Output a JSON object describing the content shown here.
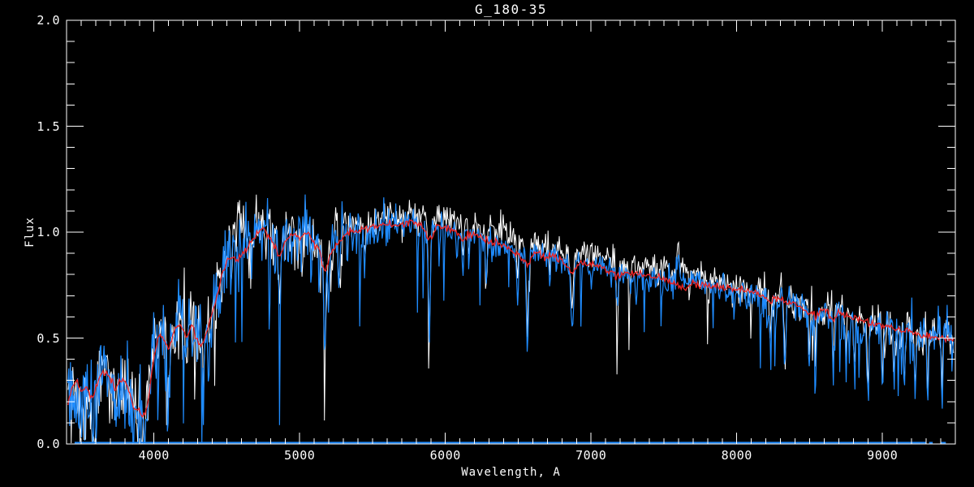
{
  "window": {
    "background": "#000000"
  },
  "chart_data": {
    "type": "line",
    "title": "G_180-35",
    "xlabel": "Wavelength, A",
    "ylabel": "Flux",
    "xlim": [
      3400,
      9500
    ],
    "ylim": [
      0.0,
      2.0
    ],
    "grid": false,
    "legend": null,
    "axis_color": "#ffffff",
    "background_color": "#000000",
    "x_major_ticks": [
      4000,
      5000,
      6000,
      7000,
      8000,
      9000
    ],
    "x_tick_labels": [
      "4000",
      "5000",
      "6000",
      "7000",
      "8000",
      "9000"
    ],
    "x_minor_step": 100,
    "y_major_ticks": [
      0.0,
      0.5,
      1.0,
      1.5,
      2.0
    ],
    "y_tick_labels": [
      "0.0",
      "0.5",
      "1.0",
      "1.5",
      "2.0"
    ],
    "y_minor_step": 0.1,
    "series": [
      {
        "name": "observed-spectrum-white",
        "color": "#ffffff",
        "role": "noisy observed spectrum (drawn first, visible behind blue)",
        "seed": 7654321,
        "sigma_scale": 0.95,
        "line_scale": 0.85,
        "dip_scale": 0.55,
        "spike_scale": 1.0,
        "offset_profile": [
          [
            3400,
            0.005
          ],
          [
            5200,
            0.01
          ],
          [
            5500,
            0.045
          ],
          [
            6600,
            0.05
          ],
          [
            7200,
            0.04
          ],
          [
            7800,
            0.03
          ],
          [
            8400,
            0.025
          ],
          [
            9000,
            0.02
          ],
          [
            9500,
            0.015
          ]
        ]
      },
      {
        "name": "observed-spectrum-blue",
        "color": "#1f8cff",
        "role": "noisy observed spectrum overlay",
        "seed": 1234567,
        "sigma_scale": 1.0,
        "line_scale": 1.0,
        "dip_scale": 1.0,
        "spike_scale": 1.0,
        "offset_profile": [
          [
            3400,
            0.0
          ],
          [
            9500,
            0.0
          ]
        ]
      },
      {
        "name": "model-spectrum-red",
        "color": "#f02424",
        "role": "smooth template / model spectrum",
        "seed": 24601,
        "sigma": 0.009,
        "step_angstrom": 8
      }
    ],
    "continuum_anchors": [
      [
        3410,
        0.25
      ],
      [
        3440,
        0.3
      ],
      [
        3470,
        0.24
      ],
      [
        3500,
        0.21
      ],
      [
        3530,
        0.3
      ],
      [
        3560,
        0.18
      ],
      [
        3590,
        0.16
      ],
      [
        3620,
        0.3
      ],
      [
        3650,
        0.36
      ],
      [
        3680,
        0.34
      ],
      [
        3710,
        0.3
      ],
      [
        3740,
        0.24
      ],
      [
        3770,
        0.29
      ],
      [
        3800,
        0.27
      ],
      [
        3830,
        0.24
      ],
      [
        3860,
        0.14
      ],
      [
        3900,
        0.19
      ],
      [
        3933,
        0.12
      ],
      [
        3960,
        0.26
      ],
      [
        4000,
        0.5
      ],
      [
        4040,
        0.56
      ],
      [
        4070,
        0.52
      ],
      [
        4101,
        0.48
      ],
      [
        4140,
        0.56
      ],
      [
        4180,
        0.58
      ],
      [
        4220,
        0.57
      ],
      [
        4260,
        0.6
      ],
      [
        4300,
        0.5
      ],
      [
        4340,
        0.53
      ],
      [
        4380,
        0.6
      ],
      [
        4420,
        0.68
      ],
      [
        4460,
        0.82
      ],
      [
        4500,
        0.9
      ],
      [
        4550,
        0.95
      ],
      [
        4600,
        0.97
      ],
      [
        4650,
        1.0
      ],
      [
        4700,
        1.02
      ],
      [
        4750,
        1.03
      ],
      [
        4800,
        1.0
      ],
      [
        4861,
        0.93
      ],
      [
        4910,
        1.0
      ],
      [
        4960,
        1.01
      ],
      [
        5000,
        0.99
      ],
      [
        5050,
        1.01
      ],
      [
        5100,
        0.97
      ],
      [
        5172,
        0.86
      ],
      [
        5230,
        0.95
      ],
      [
        5300,
        1.0
      ],
      [
        5360,
        1.01
      ],
      [
        5420,
        1.0
      ],
      [
        5480,
        1.02
      ],
      [
        5540,
        1.02
      ],
      [
        5600,
        1.03
      ],
      [
        5660,
        1.03
      ],
      [
        5720,
        1.04
      ],
      [
        5780,
        1.05
      ],
      [
        5840,
        1.04
      ],
      [
        5893,
        0.98
      ],
      [
        5950,
        1.03
      ],
      [
        6000,
        1.02
      ],
      [
        6060,
        1.01
      ],
      [
        6120,
        1.0
      ],
      [
        6180,
        0.99
      ],
      [
        6240,
        0.98
      ],
      [
        6300,
        0.96
      ],
      [
        6360,
        0.95
      ],
      [
        6420,
        0.94
      ],
      [
        6480,
        0.92
      ],
      [
        6540,
        0.88
      ],
      [
        6600,
        0.9
      ],
      [
        6660,
        0.89
      ],
      [
        6720,
        0.88
      ],
      [
        6780,
        0.87
      ],
      [
        6840,
        0.84
      ],
      [
        6900,
        0.85
      ],
      [
        6960,
        0.85
      ],
      [
        7020,
        0.84
      ],
      [
        7080,
        0.83
      ],
      [
        7140,
        0.82
      ],
      [
        7200,
        0.81
      ],
      [
        7260,
        0.8
      ],
      [
        7320,
        0.8
      ],
      [
        7380,
        0.79
      ],
      [
        7440,
        0.78
      ],
      [
        7500,
        0.78
      ],
      [
        7560,
        0.77
      ],
      [
        7620,
        0.77
      ],
      [
        7680,
        0.77
      ],
      [
        7740,
        0.76
      ],
      [
        7800,
        0.75
      ],
      [
        7860,
        0.74
      ],
      [
        7920,
        0.73
      ],
      [
        7980,
        0.72
      ],
      [
        8040,
        0.715
      ],
      [
        8100,
        0.705
      ],
      [
        8160,
        0.7
      ],
      [
        8220,
        0.685
      ],
      [
        8280,
        0.67
      ],
      [
        8340,
        0.66
      ],
      [
        8400,
        0.65
      ],
      [
        8460,
        0.635
      ],
      [
        8520,
        0.62
      ],
      [
        8580,
        0.615
      ],
      [
        8640,
        0.605
      ],
      [
        8700,
        0.6
      ],
      [
        8760,
        0.59
      ],
      [
        8820,
        0.58
      ],
      [
        8880,
        0.565
      ],
      [
        8940,
        0.555
      ],
      [
        9000,
        0.545
      ],
      [
        9060,
        0.535
      ],
      [
        9120,
        0.525
      ],
      [
        9180,
        0.515
      ],
      [
        9240,
        0.51
      ],
      [
        9300,
        0.505
      ],
      [
        9360,
        0.5
      ],
      [
        9420,
        0.495
      ],
      [
        9490,
        0.485
      ]
    ],
    "model_anchors": [
      [
        3410,
        0.2
      ],
      [
        3440,
        0.27
      ],
      [
        3470,
        0.3
      ],
      [
        3500,
        0.24
      ],
      [
        3530,
        0.28
      ],
      [
        3560,
        0.22
      ],
      [
        3590,
        0.24
      ],
      [
        3620,
        0.3
      ],
      [
        3650,
        0.34
      ],
      [
        3680,
        0.33
      ],
      [
        3710,
        0.3
      ],
      [
        3740,
        0.26
      ],
      [
        3770,
        0.3
      ],
      [
        3800,
        0.29
      ],
      [
        3830,
        0.25
      ],
      [
        3860,
        0.17
      ],
      [
        3900,
        0.16
      ],
      [
        3933,
        0.13
      ],
      [
        3960,
        0.2
      ],
      [
        4000,
        0.42
      ],
      [
        4040,
        0.52
      ],
      [
        4070,
        0.49
      ],
      [
        4101,
        0.44
      ],
      [
        4140,
        0.54
      ],
      [
        4180,
        0.57
      ],
      [
        4226,
        0.5
      ],
      [
        4260,
        0.56
      ],
      [
        4300,
        0.47
      ],
      [
        4340,
        0.48
      ],
      [
        4380,
        0.58
      ],
      [
        4420,
        0.66
      ],
      [
        4460,
        0.78
      ],
      [
        4500,
        0.86
      ],
      [
        4540,
        0.89
      ],
      [
        4580,
        0.86
      ],
      [
        4620,
        0.91
      ],
      [
        4660,
        0.95
      ],
      [
        4700,
        0.99
      ],
      [
        4750,
        1.02
      ],
      [
        4800,
        0.98
      ],
      [
        4861,
        0.88
      ],
      [
        4910,
        0.97
      ],
      [
        4950,
        1.0
      ],
      [
        5000,
        0.97
      ],
      [
        5050,
        1.0
      ],
      [
        5100,
        0.95
      ],
      [
        5140,
        0.9
      ],
      [
        5172,
        0.81
      ],
      [
        5210,
        0.89
      ],
      [
        5270,
        0.96
      ],
      [
        5330,
        1.0
      ],
      [
        5400,
        1.0
      ],
      [
        5460,
        1.02
      ],
      [
        5520,
        1.02
      ],
      [
        5580,
        1.03
      ],
      [
        5640,
        1.03
      ],
      [
        5700,
        1.04
      ],
      [
        5780,
        1.05
      ],
      [
        5840,
        1.03
      ],
      [
        5893,
        0.96
      ],
      [
        5950,
        1.03
      ],
      [
        6000,
        1.02
      ],
      [
        6060,
        1.0
      ],
      [
        6122,
        0.97
      ],
      [
        6180,
        0.99
      ],
      [
        6240,
        0.98
      ],
      [
        6300,
        0.95
      ],
      [
        6360,
        0.95
      ],
      [
        6420,
        0.93
      ],
      [
        6480,
        0.9
      ],
      [
        6540,
        0.86
      ],
      [
        6563,
        0.84
      ],
      [
        6620,
        0.91
      ],
      [
        6680,
        0.89
      ],
      [
        6740,
        0.88
      ],
      [
        6800,
        0.87
      ],
      [
        6870,
        0.81
      ],
      [
        6930,
        0.86
      ],
      [
        7000,
        0.85
      ],
      [
        7060,
        0.84
      ],
      [
        7120,
        0.82
      ],
      [
        7180,
        0.79
      ],
      [
        7240,
        0.8
      ],
      [
        7300,
        0.81
      ],
      [
        7360,
        0.8
      ],
      [
        7420,
        0.79
      ],
      [
        7480,
        0.78
      ],
      [
        7540,
        0.77
      ],
      [
        7600,
        0.75
      ],
      [
        7650,
        0.73
      ],
      [
        7700,
        0.76
      ],
      [
        7760,
        0.75
      ],
      [
        7820,
        0.745
      ],
      [
        7880,
        0.74
      ],
      [
        7940,
        0.74
      ],
      [
        8000,
        0.735
      ],
      [
        8060,
        0.725
      ],
      [
        8120,
        0.715
      ],
      [
        8180,
        0.7
      ],
      [
        8230,
        0.675
      ],
      [
        8280,
        0.685
      ],
      [
        8340,
        0.675
      ],
      [
        8400,
        0.66
      ],
      [
        8460,
        0.64
      ],
      [
        8498,
        0.615
      ],
      [
        8520,
        0.635
      ],
      [
        8542,
        0.59
      ],
      [
        8580,
        0.635
      ],
      [
        8620,
        0.625
      ],
      [
        8662,
        0.58
      ],
      [
        8700,
        0.625
      ],
      [
        8760,
        0.605
      ],
      [
        8820,
        0.595
      ],
      [
        8880,
        0.578
      ],
      [
        8940,
        0.565
      ],
      [
        9000,
        0.558
      ],
      [
        9060,
        0.548
      ],
      [
        9120,
        0.54
      ],
      [
        9180,
        0.53
      ],
      [
        9240,
        0.52
      ],
      [
        9300,
        0.51
      ],
      [
        9360,
        0.505
      ],
      [
        9420,
        0.5
      ],
      [
        9490,
        0.49
      ]
    ],
    "absorption_lines": [
      [
        3581,
        0.14,
        8
      ],
      [
        3737,
        0.1,
        6
      ],
      [
        3860,
        0.1,
        9
      ],
      [
        3890,
        0.12,
        7
      ],
      [
        3933,
        0.2,
        7
      ],
      [
        3970,
        0.12,
        6
      ],
      [
        4026,
        0.16,
        5
      ],
      [
        4101,
        0.28,
        7
      ],
      [
        4144,
        0.15,
        5
      ],
      [
        4226,
        0.22,
        5
      ],
      [
        4340,
        0.28,
        6
      ],
      [
        4383,
        0.22,
        5
      ],
      [
        4455,
        0.18,
        5
      ],
      [
        4531,
        0.22,
        5
      ],
      [
        4668,
        0.25,
        5
      ],
      [
        4861,
        0.3,
        6
      ],
      [
        4920,
        0.18,
        4
      ],
      [
        5015,
        0.15,
        4
      ],
      [
        5172,
        0.45,
        8
      ],
      [
        5270,
        0.28,
        6
      ],
      [
        5328,
        0.2,
        5
      ],
      [
        5446,
        0.18,
        4
      ],
      [
        5890,
        0.45,
        7
      ],
      [
        6122,
        0.22,
        5
      ],
      [
        6162,
        0.18,
        4
      ],
      [
        6280,
        0.22,
        5
      ],
      [
        6495,
        0.22,
        5
      ],
      [
        6563,
        0.45,
        7
      ],
      [
        6717,
        0.18,
        4
      ],
      [
        6870,
        0.28,
        9
      ],
      [
        7180,
        0.18,
        7
      ],
      [
        8230,
        0.18,
        8
      ],
      [
        8330,
        0.28,
        5
      ],
      [
        8498,
        0.25,
        5
      ],
      [
        8542,
        0.3,
        5
      ],
      [
        8662,
        0.3,
        5
      ],
      [
        8750,
        0.25,
        5
      ],
      [
        8807,
        0.3,
        5
      ],
      [
        8900,
        0.32,
        6
      ],
      [
        9000,
        0.3,
        5
      ],
      [
        9080,
        0.26,
        5
      ],
      [
        9150,
        0.26,
        5
      ],
      [
        9225,
        0.3,
        5
      ],
      [
        9310,
        0.26,
        5
      ],
      [
        9410,
        0.28,
        5
      ]
    ],
    "emission_spikes": [
      [
        7600,
        0.16,
        5
      ],
      [
        7585,
        0.07,
        3
      ],
      [
        7618,
        0.06,
        3
      ]
    ],
    "noise": {
      "sample_step_angstrom": 5.5,
      "data_start": 3410,
      "data_end": 9492,
      "sigma_profile": [
        [
          3400,
          0.105
        ],
        [
          4400,
          0.095
        ],
        [
          5000,
          0.075
        ],
        [
          5400,
          0.05
        ],
        [
          5800,
          0.038
        ],
        [
          6500,
          0.034
        ],
        [
          7000,
          0.033
        ],
        [
          7600,
          0.036
        ],
        [
          8200,
          0.042
        ],
        [
          8800,
          0.046
        ],
        [
          9500,
          0.052
        ]
      ],
      "deep_dip_probability": [
        [
          3400,
          0.1
        ],
        [
          4400,
          0.09
        ],
        [
          5400,
          0.05
        ],
        [
          6000,
          0.05
        ],
        [
          7000,
          0.05
        ],
        [
          8000,
          0.06
        ],
        [
          9500,
          0.07
        ]
      ],
      "deep_dip_max_depth": [
        [
          3400,
          0.28
        ],
        [
          4500,
          0.55
        ],
        [
          5500,
          0.5
        ],
        [
          6500,
          0.45
        ],
        [
          7500,
          0.35
        ],
        [
          8500,
          0.32
        ],
        [
          9500,
          0.27
        ]
      ]
    },
    "zero_line": {
      "color": "#1f8cff",
      "flux": 0.006,
      "segments": [
        [
          3455,
          9300
        ],
        [
          9320,
          9345
        ],
        [
          9400,
          9435
        ]
      ]
    }
  }
}
